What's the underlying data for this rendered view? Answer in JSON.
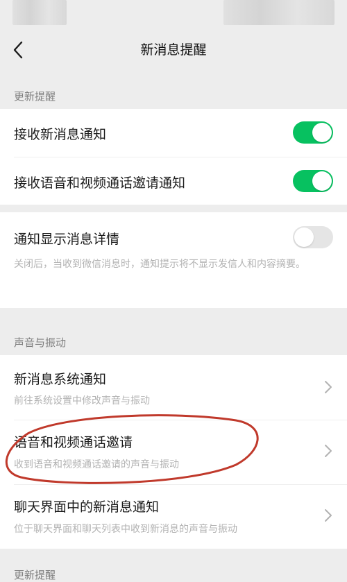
{
  "nav": {
    "title": "新消息提醒"
  },
  "sections": {
    "update_header": "更新提醒",
    "sound_header": "声音与振动",
    "bottom_header": "更新提醒"
  },
  "settings": {
    "receive_new_messages": {
      "label": "接收新消息通知",
      "state": "on"
    },
    "receive_voice_video": {
      "label": "接收语音和视频通话邀请通知",
      "state": "on"
    },
    "show_details": {
      "label": "通知显示消息详情",
      "state": "off",
      "description": "关闭后，当收到微信消息时，通知提示将不显示发信人和内容摘要。"
    }
  },
  "sound_items": [
    {
      "label": "新消息系统通知",
      "description": "前往系统设置中修改声音与振动"
    },
    {
      "label": "语音和视频通话邀请",
      "description": "收到语音和视频通话邀请的声音与振动"
    },
    {
      "label": "聊天界面中的新消息通知",
      "description": "位于聊天界面和聊天列表中收到新消息的声音与振动"
    }
  ],
  "colors": {
    "accent": "#07c160",
    "background": "#ededed",
    "annotation": "#c0392b"
  },
  "icons": {
    "back": "back-chevron-icon",
    "row_arrow": "chevron-right-icon"
  }
}
